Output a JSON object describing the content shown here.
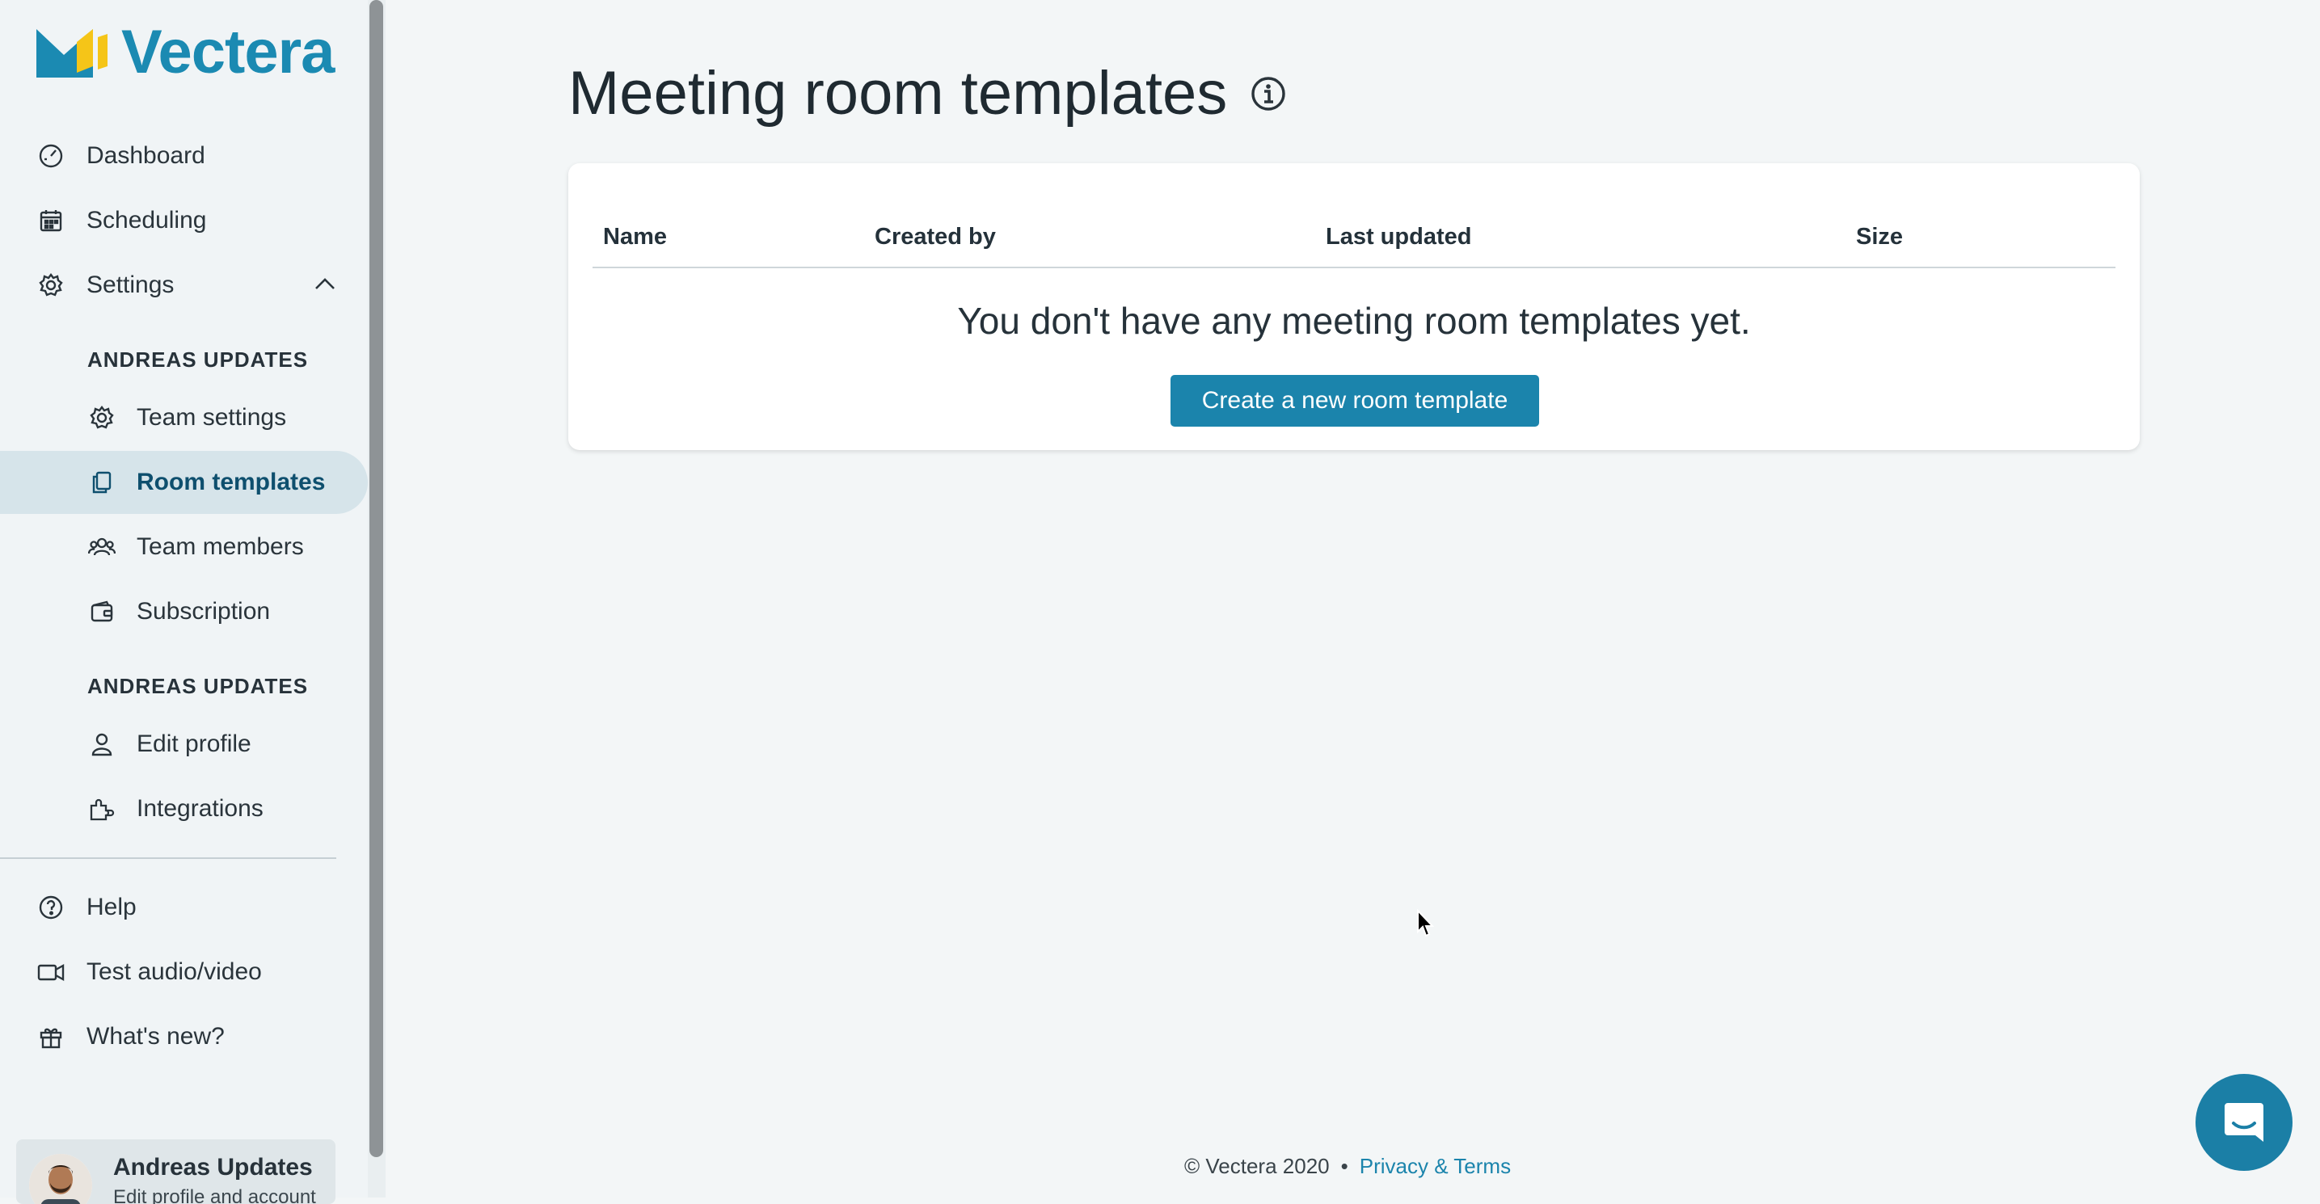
{
  "brand": {
    "name": "Vectera",
    "color": "#1b8ab2",
    "accent": "#f5c518"
  },
  "sidebar": {
    "top_items": [
      {
        "label": "Dashboard",
        "icon": "dashboard-icon"
      },
      {
        "label": "Scheduling",
        "icon": "calendar-icon"
      },
      {
        "label": "Settings",
        "icon": "gear-icon"
      }
    ],
    "team_section": "ANDREAS UPDATES",
    "team_items": [
      {
        "label": "Team settings",
        "icon": "gear-icon"
      },
      {
        "label": "Room templates",
        "icon": "copy-icon",
        "active": true
      },
      {
        "label": "Team members",
        "icon": "users-icon"
      },
      {
        "label": "Subscription",
        "icon": "wallet-icon"
      }
    ],
    "profile_section": "ANDREAS UPDATES",
    "profile_items": [
      {
        "label": "Edit profile",
        "icon": "user-icon"
      },
      {
        "label": "Integrations",
        "icon": "puzzle-icon"
      }
    ],
    "bottom_items": [
      {
        "label": "Help",
        "icon": "help-icon"
      },
      {
        "label": "Test audio/video",
        "icon": "video-icon"
      },
      {
        "label": "What's new?",
        "icon": "gift-icon"
      }
    ],
    "user": {
      "name": "Andreas Updates",
      "subtitle": "Edit profile and account"
    }
  },
  "main": {
    "title": "Meeting room templates",
    "table": {
      "columns": [
        "Name",
        "Created by",
        "Last updated",
        "Size"
      ],
      "empty_message": "You don't have any meeting room templates yet."
    },
    "create_button": "Create a new room template"
  },
  "footer": {
    "copyright": "© Vectera 2020",
    "separator": "•",
    "link": "Privacy & Terms"
  }
}
